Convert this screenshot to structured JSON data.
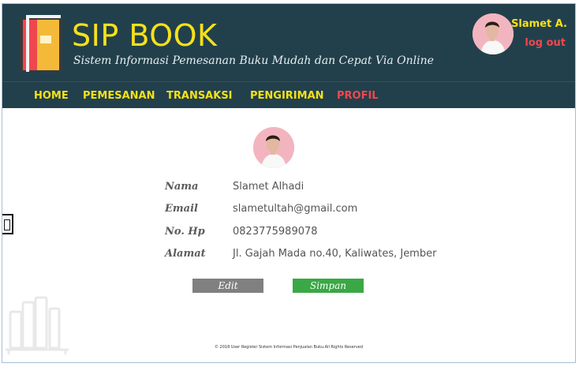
{
  "brand": {
    "title": "SIP BOOK",
    "tagline": "Sistem Informasi Pemesanan Buku Mudah dan Cepat Via Online"
  },
  "user": {
    "name": "Slamet A.",
    "logout_label": "log out"
  },
  "nav": {
    "items": [
      {
        "label": "HOME"
      },
      {
        "label": "PEMESANAN"
      },
      {
        "label": "TRANSAKSI"
      },
      {
        "label": "PENGIRIMAN"
      },
      {
        "label": "PROFIL",
        "active": true
      }
    ]
  },
  "profile": {
    "fields": [
      {
        "label": "Nama",
        "value": "Slamet Alhadi"
      },
      {
        "label": "Email",
        "value": "slametultah@gmail.com"
      },
      {
        "label": "No. Hp",
        "value": "0823775989078"
      },
      {
        "label": "Alamat",
        "value": "Jl. Gajah Mada no.40, Kaliwates, Jember"
      }
    ],
    "edit_label": "Edit",
    "save_label": "Simpan"
  },
  "footer": {
    "text": "© 2018 User Register Sistem Informasi Penjualan Buku.All Rights Reserved"
  },
  "colors": {
    "header_bg": "#22404b",
    "brand_yellow": "#f5e11a",
    "accent_red": "#f0474f",
    "save_green": "#3aa845",
    "edit_gray": "#808080"
  }
}
